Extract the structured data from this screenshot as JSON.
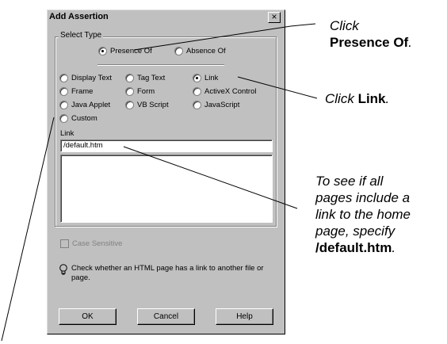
{
  "dialog": {
    "title": "Add Assertion",
    "close_glyph": "×",
    "group_label": "Select Type",
    "presence_label": "Presence Of",
    "absence_label": "Absence Of",
    "types": [
      {
        "label": "Display Text"
      },
      {
        "label": "Tag Text"
      },
      {
        "label": "Link"
      },
      {
        "label": "Frame"
      },
      {
        "label": "Form"
      },
      {
        "label": "ActiveX Control"
      },
      {
        "label": "Java Applet"
      },
      {
        "label": "VB Script"
      },
      {
        "label": "JavaScript"
      },
      {
        "label": "Custom"
      }
    ],
    "selected_type": "Link",
    "selected_mode": "Presence Of",
    "link_label": "Link",
    "link_value": "/default.htm",
    "case_sensitive_label": "Case Sensitive",
    "hint": "Check whether an HTML page has a link to another file or page.",
    "ok_label": "OK",
    "cancel_label": "Cancel",
    "help_label": "Help"
  },
  "callouts": {
    "presence_1": "Click",
    "presence_2": "Presence Of",
    "presence_3": ".",
    "link_1": "Click ",
    "link_2": "Link",
    "link_3": ".",
    "home_1": "To see if all",
    "home_2": "pages include a",
    "home_3": "link to the home",
    "home_4": "page, specify",
    "home_5": "/default.htm",
    "home_6": "."
  }
}
